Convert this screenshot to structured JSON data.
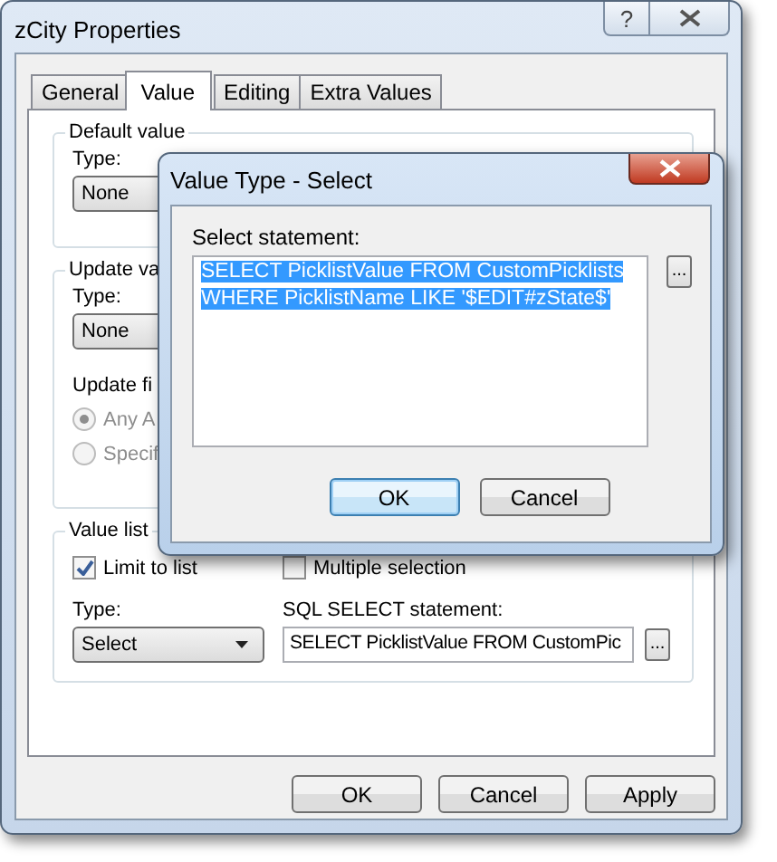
{
  "window": {
    "title": "zCity Properties",
    "help_glyph": "?"
  },
  "tabs": [
    {
      "label": "General",
      "selected": false
    },
    {
      "label": "Value",
      "selected": true
    },
    {
      "label": "Editing",
      "selected": false
    },
    {
      "label": "Extra Values",
      "selected": false
    }
  ],
  "default_value": {
    "legend": "Default value",
    "type_label": "Type:",
    "type_value": "None"
  },
  "update_value": {
    "legend": "Update va",
    "type_label": "Type:",
    "type_value": "None",
    "update_label": "Update fi",
    "options": [
      {
        "label": "Any A",
        "selected": true,
        "disabled": true
      },
      {
        "label": "Specif",
        "selected": false,
        "disabled": true
      }
    ]
  },
  "value_list": {
    "legend": "Value list",
    "checkboxes": [
      {
        "label": "Limit to list",
        "checked": true
      },
      {
        "label": "Multiple selection",
        "checked": false
      }
    ],
    "type_label": "Type:",
    "type_value": "Select",
    "sql_label": "SQL SELECT statement:",
    "sql_value": "SELECT PicklistValue FROM CustomPic",
    "browse_button": "..."
  },
  "buttons": [
    "OK",
    "Cancel",
    "Apply"
  ],
  "dialog": {
    "title": "Value Type - Select",
    "statement_label": "Select statement:",
    "statement_lines": [
      "SELECT PicklistValue FROM CustomPicklists",
      "WHERE PicklistName LIKE '$EDIT#zState$'"
    ],
    "text_selected": true,
    "browse_button": "...",
    "buttons": [
      {
        "label": "OK",
        "default": true
      },
      {
        "label": "Cancel",
        "default": false
      }
    ]
  }
}
